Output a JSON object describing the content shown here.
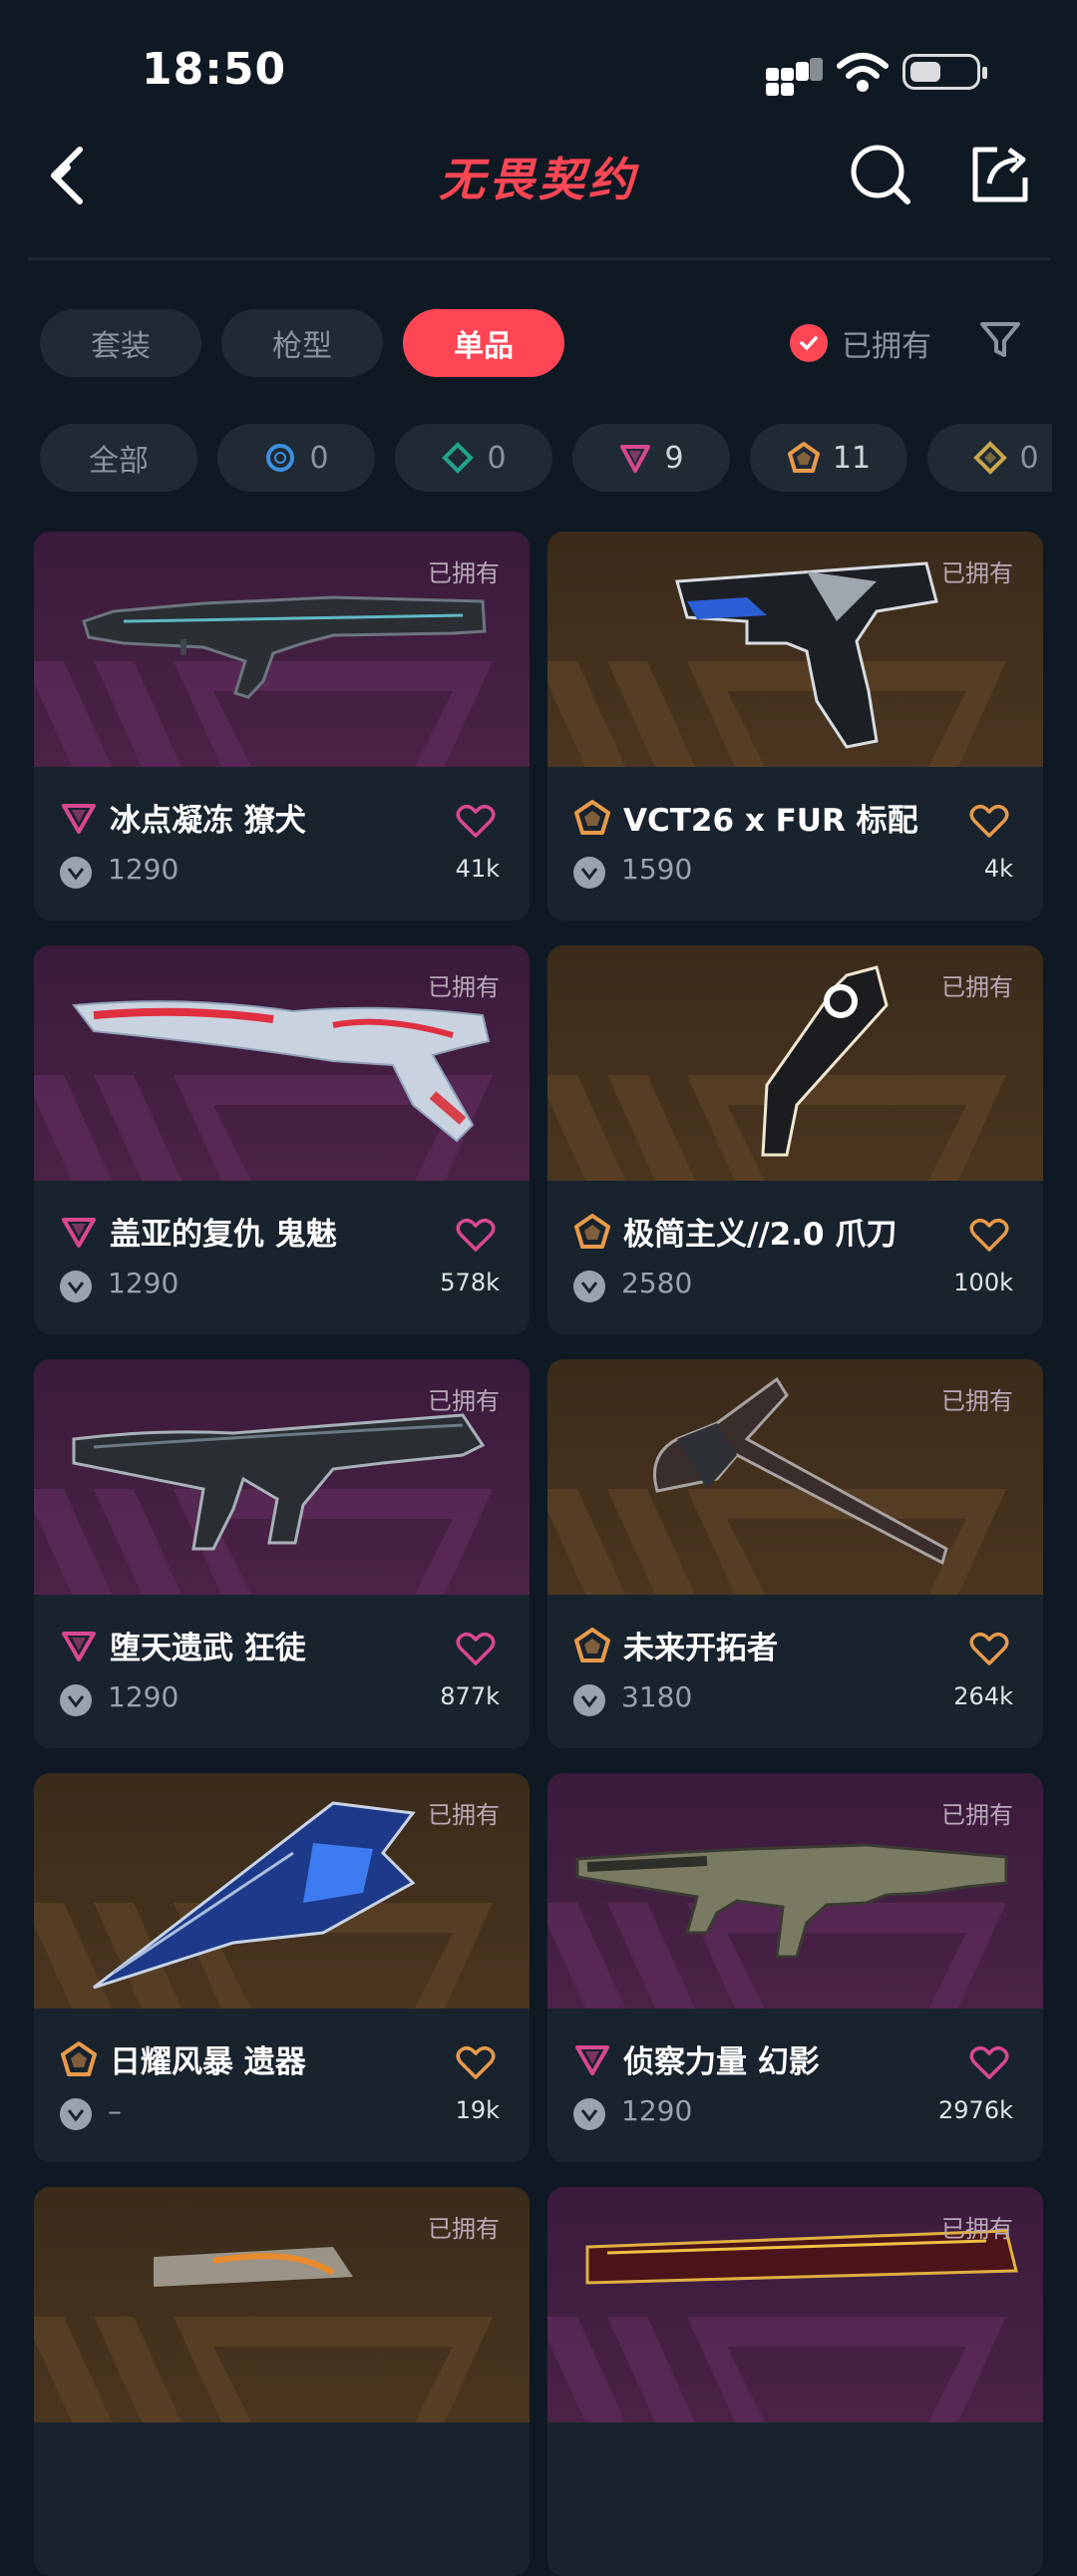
{
  "status": {
    "time": "18:50"
  },
  "nav": {
    "title": "无畏契约",
    "back_icon": "back-arrow-icon",
    "search_icon": "search-icon",
    "share_icon": "share-icon"
  },
  "tabs": [
    {
      "label": "套装",
      "active": false
    },
    {
      "label": "枪型",
      "active": false
    },
    {
      "label": "单品",
      "active": true
    }
  ],
  "owned_filter": {
    "label": "已拥有",
    "checked": true
  },
  "rarity_filters": [
    {
      "label": "全部"
    },
    {
      "icon": "select-tier-icon",
      "color": "#3d8fe0",
      "count": "0"
    },
    {
      "icon": "deluxe-tier-icon",
      "color": "#1fa58a",
      "count": "0"
    },
    {
      "icon": "premium-tier-icon",
      "color": "#d9478f",
      "count": "9"
    },
    {
      "icon": "ultra-tier-icon",
      "color": "#e89a4a",
      "count": "11"
    },
    {
      "icon": "exclusive-tier-icon",
      "color": "#c9a64a",
      "count": "0"
    }
  ],
  "colors": {
    "accent": "#ff4655",
    "premium": "#d9478f",
    "ultra": "#e89a4a"
  },
  "items": [
    {
      "name": "冰点凝冻 獠犬",
      "price": "1290",
      "likes": "41k",
      "owned": "已拥有",
      "tier": "premium",
      "bg": "purple",
      "weapon": "rifle"
    },
    {
      "name": "VCT26 x FUR 标配",
      "price": "1590",
      "likes": "4k",
      "owned": "已拥有",
      "tier": "ultra",
      "bg": "gold",
      "weapon": "pistol"
    },
    {
      "name": "盖亚的复仇 鬼魅",
      "price": "1290",
      "likes": "578k",
      "owned": "已拥有",
      "tier": "premium",
      "bg": "purple",
      "weapon": "sidearm"
    },
    {
      "name": "极简主义//2.0 爪刀",
      "price": "2580",
      "likes": "100k",
      "owned": "已拥有",
      "tier": "ultra",
      "bg": "gold",
      "weapon": "karambit"
    },
    {
      "name": "堕天遗武 狂徒",
      "price": "1290",
      "likes": "877k",
      "owned": "已拥有",
      "tier": "premium",
      "bg": "purple",
      "weapon": "ak"
    },
    {
      "name": "未来开拓者",
      "price": "3180",
      "likes": "264k",
      "owned": "已拥有",
      "tier": "ultra",
      "bg": "gold",
      "weapon": "axe"
    },
    {
      "name": "日耀风暴 遗器",
      "price": "–",
      "likes": "19k",
      "owned": "已拥有",
      "tier": "ultra",
      "bg": "gold",
      "weapon": "blade"
    },
    {
      "name": "侦察力量 幻影",
      "price": "1290",
      "likes": "2976k",
      "owned": "已拥有",
      "tier": "premium",
      "bg": "purple",
      "weapon": "phantom"
    },
    {
      "name": "",
      "price": "",
      "likes": "",
      "owned": "已拥有",
      "tier": "ultra",
      "bg": "gold",
      "weapon": "partial"
    },
    {
      "name": "",
      "price": "",
      "likes": "",
      "owned": "已拥有",
      "tier": "premium",
      "bg": "purple",
      "weapon": "partial2"
    }
  ]
}
